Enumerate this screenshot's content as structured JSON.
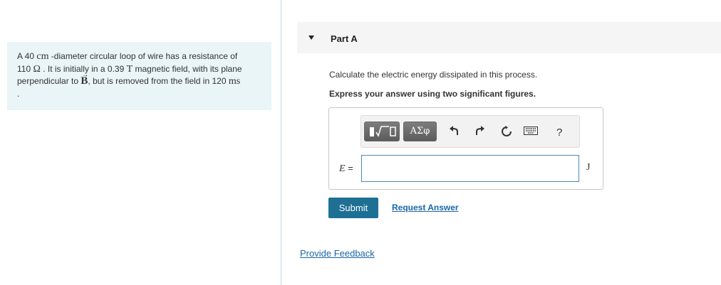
{
  "problem": {
    "seg1": "A 40 ",
    "unit_cm": "cm",
    "seg2": " -diameter circular loop of wire has a resistance of",
    "seg3": "110 ",
    "unit_ohm": "Ω",
    "seg4": " . It is initially in a 0.39 ",
    "unit_T": "T",
    "seg5": " magnetic field, with its plane",
    "seg6": "perpendicular to ",
    "vector_B": "B",
    "vector_arrow": "→",
    "seg7": ", but is removed from the field in 120 ",
    "unit_ms": "ms",
    "seg8": "."
  },
  "part": {
    "title": "Part A",
    "question": "Calculate the electric energy dissipated in this process.",
    "instruction": "Express your answer using two significant figures."
  },
  "toolbar": {
    "greek_label": "ΑΣφ",
    "help_label": "?",
    "icons": [
      "templates-icon",
      "undo-icon",
      "redo-icon",
      "reset-icon",
      "keyboard-icon",
      "help-icon"
    ]
  },
  "answer": {
    "variable": "E",
    "equals": " =",
    "value": "",
    "unit": "J"
  },
  "actions": {
    "submit": "Submit",
    "request_answer": "Request Answer",
    "provide_feedback": "Provide Feedback"
  },
  "colors": {
    "problem_bg": "#e9f5f7",
    "submit_bg": "#1d6f94",
    "link": "#1a66a8",
    "input_border": "#4a8ab8"
  }
}
